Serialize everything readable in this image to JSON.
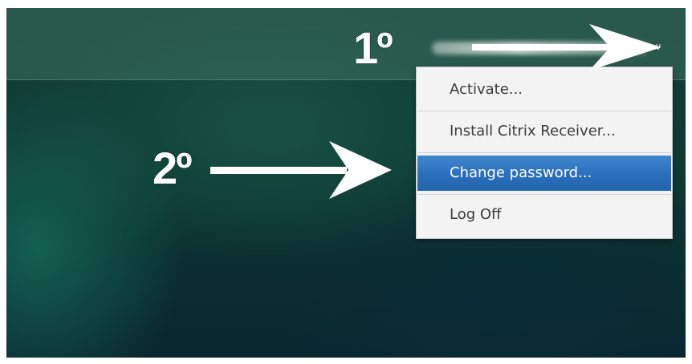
{
  "header": {
    "user_name": "",
    "dropdown_icon": "chevron-down-icon"
  },
  "annotations": {
    "step1": "1º",
    "step2": "2º",
    "arrow_color": "#ffffff"
  },
  "menu": {
    "items": [
      {
        "label": "Activate...",
        "selected": false
      },
      {
        "label": "Install Citrix Receiver...",
        "selected": false
      },
      {
        "label": "Change password...",
        "selected": true
      },
      {
        "label": "Log Off",
        "selected": false
      }
    ],
    "selected_color": "#2f74c0"
  }
}
